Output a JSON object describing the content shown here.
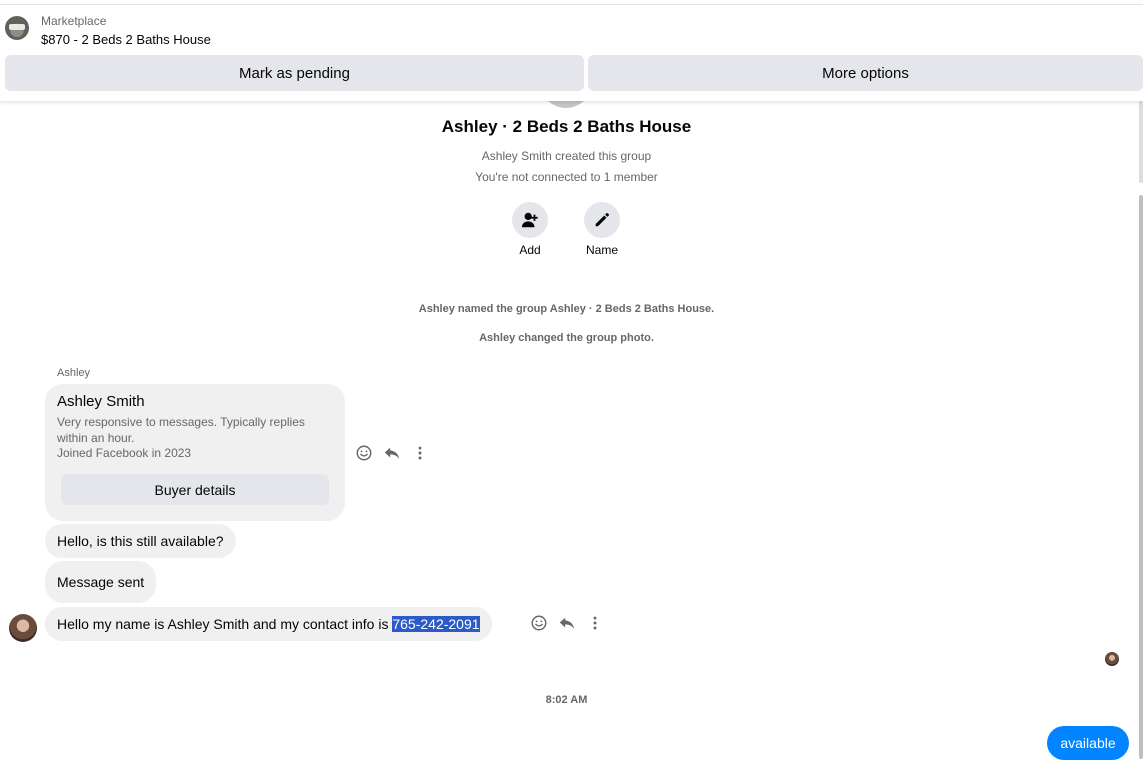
{
  "header": {
    "category": "Marketplace",
    "listing_title": "$870 - 2 Beds 2 Baths House",
    "mark_pending_label": "Mark as pending",
    "more_options_label": "More options"
  },
  "group": {
    "title": "Ashley · 2 Beds 2 Baths House",
    "created_by": "Ashley Smith created this group",
    "connection_note": "You're not connected to 1 member",
    "actions": [
      {
        "label": "Add",
        "icon": "add-person-icon"
      },
      {
        "label": "Name",
        "icon": "pencil-icon"
      }
    ]
  },
  "system_messages": [
    "Ashley named the group Ashley · 2 Beds 2 Baths House.",
    "Ashley changed the group photo."
  ],
  "thread": {
    "sender_label": "Ashley",
    "profile_card": {
      "name": "Ashley Smith",
      "description": "Very responsive to messages. Typically replies within an hour.",
      "joined": "Joined Facebook in 2023",
      "button_label": "Buyer details"
    },
    "messages": [
      {
        "text": "Hello, is this still available?"
      },
      {
        "text": "Message sent"
      },
      {
        "text_prefix": "Hello my name is Ashley Smith and my contact info is ",
        "highlighted": "765-242-2091"
      }
    ],
    "timestamp": "8:02 AM",
    "outgoing": {
      "text": "available"
    }
  },
  "colors": {
    "accent": "#0084ff",
    "bubble": "#f0f0f0",
    "button": "#e4e6eb",
    "highlight": "#2a5bc9",
    "secondary_text": "#65676b"
  }
}
